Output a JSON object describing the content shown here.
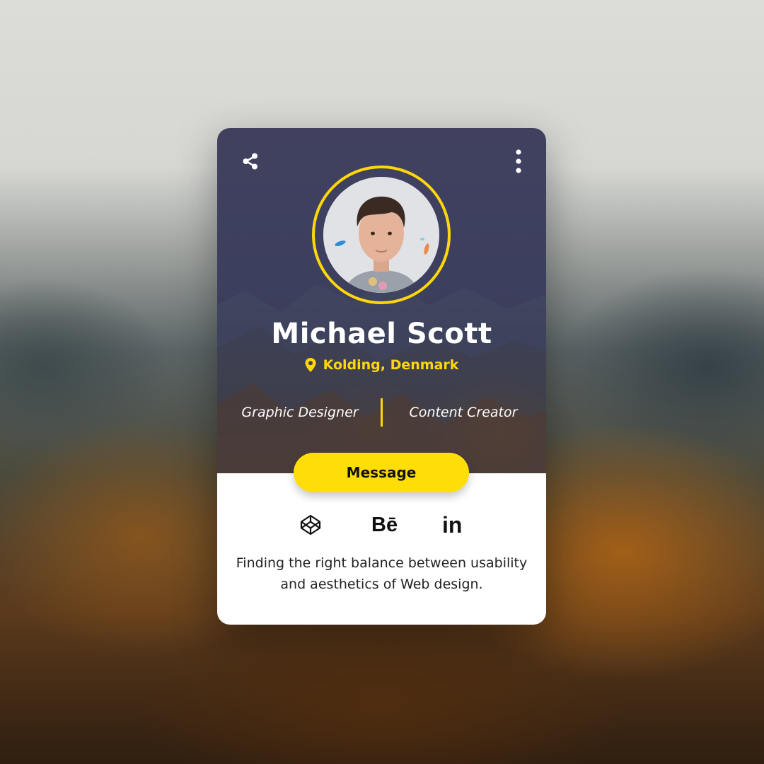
{
  "profile": {
    "name": "Michael Scott",
    "location": "Kolding, Denmark",
    "roles": [
      "Graphic Designer",
      "Content Creator"
    ],
    "bio": "Finding the right balance between usability and aesthetics of Web design."
  },
  "actions": {
    "message_label": "Message"
  },
  "social": {
    "behance_label": "Bē",
    "linkedin_label": "in"
  },
  "icons": {
    "share": "share-icon",
    "more": "more-vertical-icon",
    "location": "location-pin-icon",
    "codepen": "codepen-icon",
    "behance": "behance-icon",
    "linkedin": "linkedin-icon"
  },
  "colors": {
    "accent": "#ffd70a",
    "card_header": "#3d3f5f",
    "card_body": "#ffffff",
    "button": "#ffde08"
  }
}
